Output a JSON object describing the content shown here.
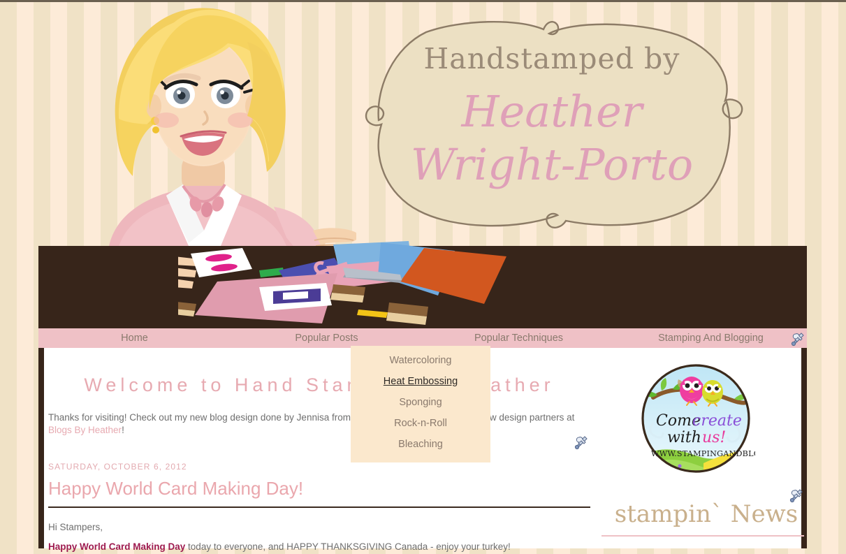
{
  "site": {
    "title_line1": "Handstamped by",
    "title_line2": "Heather",
    "title_line3": "Wright-Porto"
  },
  "nav": {
    "items": [
      {
        "label": "Home",
        "has_menu": false
      },
      {
        "label": "Popular Posts",
        "has_menu": false
      },
      {
        "label": "Popular Techniques",
        "has_menu": true
      },
      {
        "label": "Stamping And Blogging",
        "has_menu": false
      }
    ],
    "edit_icon": "wrench-screwdriver-icon"
  },
  "dropdown": {
    "open": true,
    "parent": "Popular Techniques",
    "items": [
      {
        "label": "Watercoloring",
        "active": false
      },
      {
        "label": "Heat Embossing",
        "active": true
      },
      {
        "label": "Sponging",
        "active": false
      },
      {
        "label": "Rock-n-Roll",
        "active": false
      },
      {
        "label": "Bleaching",
        "active": false
      }
    ]
  },
  "main": {
    "welcome_heading": "Welcome to Hand Stamped by Heather",
    "intro_before_link": "Thanks for visiting! Check out my new blog design done by Jennisa from Blogs By Heather - one of my new design partners at ",
    "intro_link": "Blogs By Heather",
    "intro_after_link": "!",
    "post": {
      "date": "SATURDAY, OCTOBER 6, 2012",
      "title": "Happy World Card Making Day!",
      "greeting": "Hi Stampers,",
      "body_strong": "Happy World Card Making Day",
      "body_rest": " today to everyone, and HAPPY THANKSGIVING Canada - enjoy your turkey!"
    },
    "edit_icon": "wrench-screwdriver-icon"
  },
  "sidebar": {
    "badge": {
      "line1": "Come",
      "line2": "create",
      "line3": "with",
      "line4": "us!",
      "url": "WWW.STAMPINGANDBLOGGING.COM",
      "name": "come-create-with-us-badge"
    },
    "news_heading": "stampin` News",
    "edit_icon": "wrench-screwdriver-icon"
  },
  "colors": {
    "nav_bg": "#efc1c6",
    "dropdown_bg": "#fbe8cd",
    "frame_brown": "#37251a",
    "accent_pink": "#e7aab1",
    "script_pink": "#dfa0b8",
    "stripe_dark": "#f0e2c6",
    "stripe_light": "#fdebd8",
    "body_text": "#6f6f6f",
    "strong_magenta": "#9e1b4f"
  }
}
